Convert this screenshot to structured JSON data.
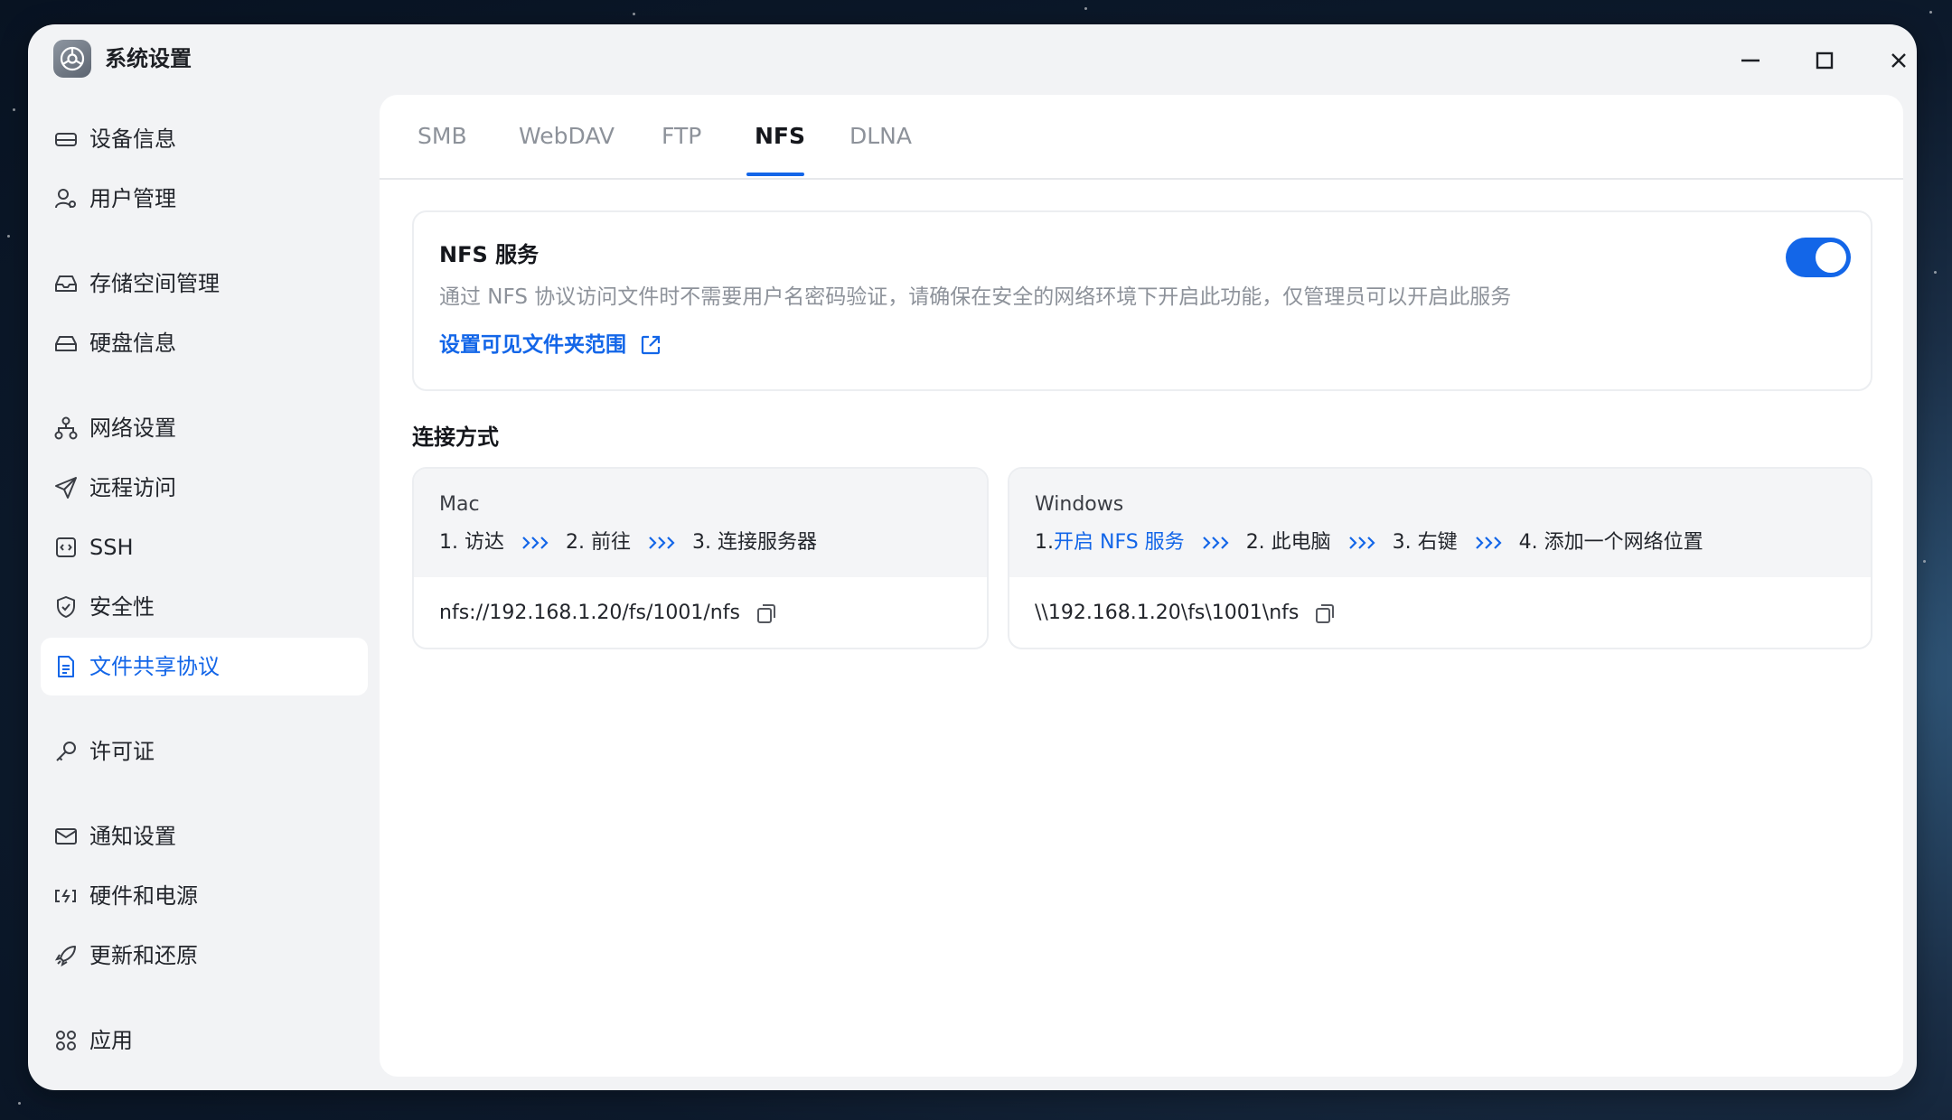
{
  "window": {
    "title": "系统设置"
  },
  "sidebar": {
    "items": [
      {
        "label": "设备信息",
        "icon": "device-icon"
      },
      {
        "label": "用户管理",
        "icon": "user-icon"
      },
      {
        "label": "存储空间管理",
        "icon": "storage-icon"
      },
      {
        "label": "硬盘信息",
        "icon": "disk-icon"
      },
      {
        "label": "网络设置",
        "icon": "network-icon"
      },
      {
        "label": "远程访问",
        "icon": "send-icon"
      },
      {
        "label": "SSH",
        "icon": "ssh-icon"
      },
      {
        "label": "安全性",
        "icon": "shield-icon"
      },
      {
        "label": "文件共享协议",
        "icon": "document-icon",
        "active": true
      },
      {
        "label": "许可证",
        "icon": "key-icon"
      },
      {
        "label": "通知设置",
        "icon": "mail-icon"
      },
      {
        "label": "硬件和电源",
        "icon": "battery-icon"
      },
      {
        "label": "更新和还原",
        "icon": "rocket-icon"
      },
      {
        "label": "应用",
        "icon": "apps-icon"
      }
    ]
  },
  "tabs": [
    {
      "label": "SMB"
    },
    {
      "label": "WebDAV"
    },
    {
      "label": "FTP"
    },
    {
      "label": "NFS",
      "active": true
    },
    {
      "label": "DLNA"
    }
  ],
  "nfs_service": {
    "title": "NFS 服务",
    "description": "通过 NFS 协议访问文件时不需要用户名密码验证，请确保在安全的网络环境下开启此功能，仅管理员可以开启此服务",
    "link_label": "设置可见文件夹范围",
    "enabled": true
  },
  "connection": {
    "title": "连接方式",
    "mac": {
      "os": "Mac",
      "steps": [
        "1. 访达",
        "2. 前往",
        "3. 连接服务器"
      ],
      "path": "nfs://192.168.1.20/fs/1001/nfs"
    },
    "windows": {
      "os": "Windows",
      "step1_prefix": "1. ",
      "step1_link": "开启 NFS 服务",
      "steps": [
        "2. 此电脑",
        "3. 右键",
        "4. 添加一个网络位置"
      ],
      "path": "\\\\192.168.1.20\\fs\\1001\\nfs"
    }
  },
  "colors": {
    "accent": "#1366e8",
    "muted_text": "#8d929a",
    "panel": "#ffffff",
    "window": "#f2f3f5"
  }
}
